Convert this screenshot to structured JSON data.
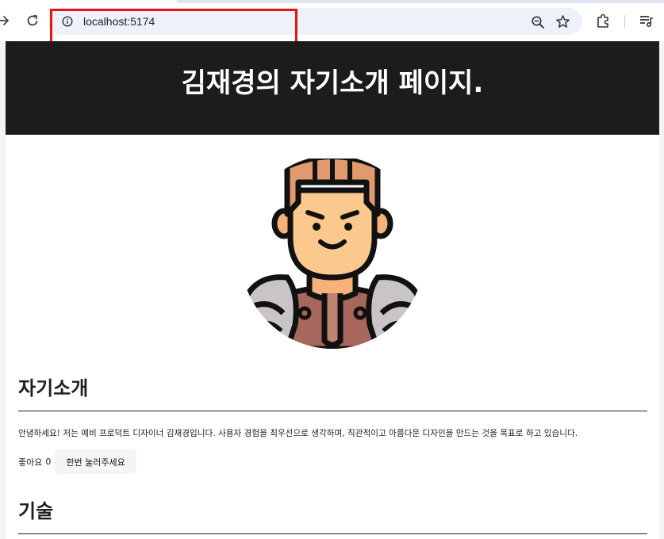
{
  "browser": {
    "url": "localhost:5174",
    "icons": {
      "forward": "arrow-right-icon",
      "reload": "reload-icon",
      "site_info": "info-icon",
      "zoom": "zoom-out-icon",
      "bookmark": "star-icon",
      "extensions": "puzzle-icon",
      "media": "media-queue-icon"
    },
    "annotation_color": "#ee1111"
  },
  "page": {
    "header_title": "김재경의 자기소개 페이지.",
    "header_bg": "#1c1c1c",
    "avatar_icon": "warrior-avatar-icon",
    "sections": {
      "intro": {
        "heading": "자기소개",
        "body": "안녕하세요! 저는 예비 프로덕트 디자이너 김재경입니다. 사용자 경험을 최우선으로 생각하며, 직관적이고 아름다운 디자인을 만드는 것을 목표로 하고 있습니다.",
        "like_label": "좋아요",
        "like_count": "0",
        "like_button_label": "한번 눌러주세요"
      },
      "skills": {
        "heading": "기술"
      }
    }
  }
}
